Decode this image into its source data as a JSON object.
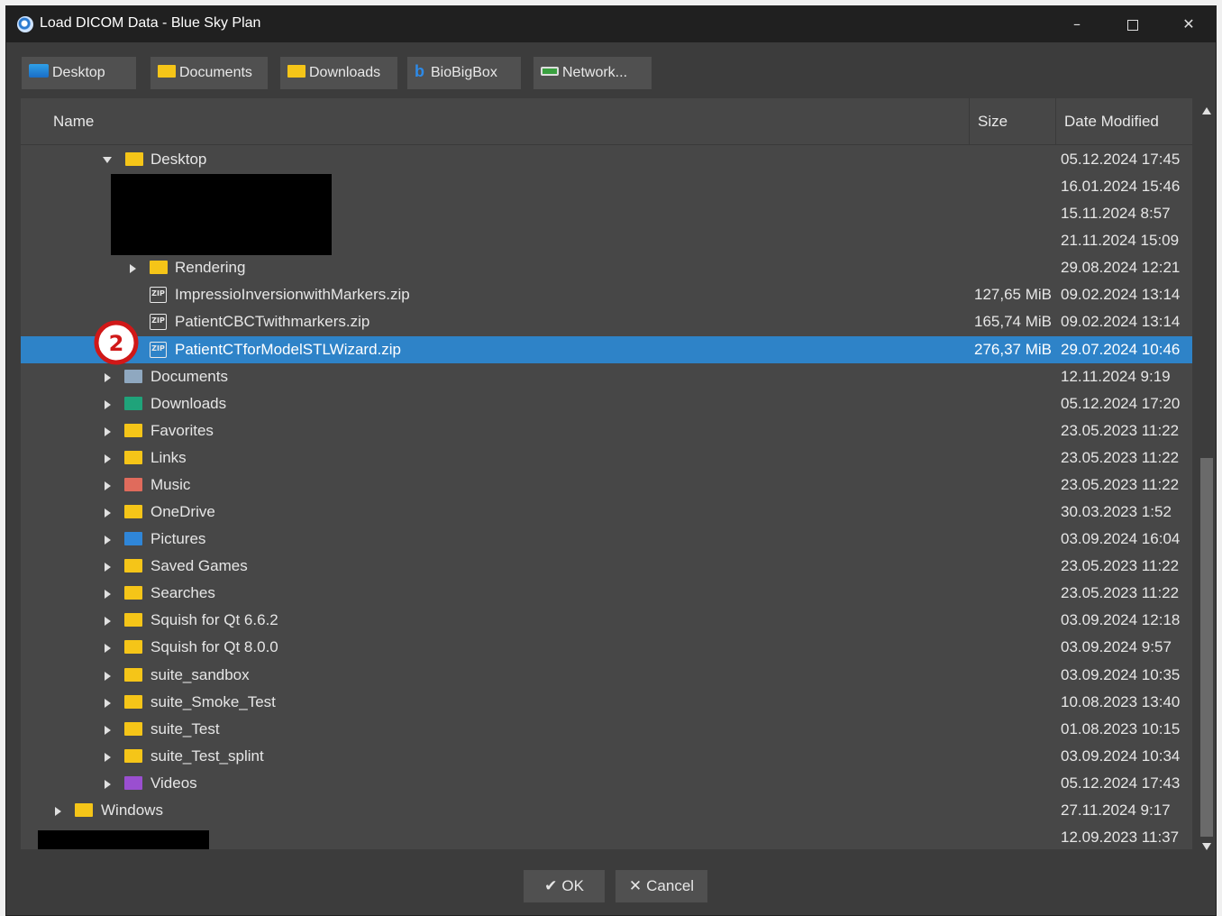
{
  "window": {
    "title": "Load DICOM Data - Blue Sky Plan",
    "minimize": "–",
    "close": "✕"
  },
  "places": [
    {
      "label": "Desktop",
      "icon": "desktop-icon"
    },
    {
      "label": "Documents",
      "icon": "folder-icon"
    },
    {
      "label": "Downloads",
      "icon": "folder-icon"
    },
    {
      "label": "BioBigBox",
      "icon": "biobigbox-icon"
    },
    {
      "label": "Network...",
      "icon": "network-icon"
    }
  ],
  "columns": {
    "name": "Name",
    "size": "Size",
    "date": "Date Modified"
  },
  "rows": [
    {
      "name": "Desktop",
      "size": "",
      "date": "05.12.2024 17:45"
    },
    {
      "name": "",
      "size": "",
      "date": "16.01.2024 15:46"
    },
    {
      "name": "",
      "size": "",
      "date": "15.11.2024 8:57"
    },
    {
      "name": "",
      "size": "",
      "date": "21.11.2024 15:09"
    },
    {
      "name": "Rendering",
      "size": "",
      "date": "29.08.2024 12:21"
    },
    {
      "name": "ImpressioInversionwithMarkers.zip",
      "size": "127,65 MiB",
      "date": "09.02.2024 13:14"
    },
    {
      "name": "PatientCBCTwithmarkers.zip",
      "size": "165,74 MiB",
      "date": "09.02.2024 13:14"
    },
    {
      "name": "PatientCTforModelSTLWizard.zip",
      "size": "276,37 MiB",
      "date": "29.07.2024 10:46"
    },
    {
      "name": "Documents",
      "size": "",
      "date": "12.11.2024 9:19"
    },
    {
      "name": "Downloads",
      "size": "",
      "date": "05.12.2024 17:20"
    },
    {
      "name": "Favorites",
      "size": "",
      "date": "23.05.2023 11:22"
    },
    {
      "name": "Links",
      "size": "",
      "date": "23.05.2023 11:22"
    },
    {
      "name": "Music",
      "size": "",
      "date": "23.05.2023 11:22"
    },
    {
      "name": "OneDrive",
      "size": "",
      "date": "30.03.2023 1:52"
    },
    {
      "name": "Pictures",
      "size": "",
      "date": "03.09.2024 16:04"
    },
    {
      "name": "Saved Games",
      "size": "",
      "date": "23.05.2023 11:22"
    },
    {
      "name": "Searches",
      "size": "",
      "date": "23.05.2023 11:22"
    },
    {
      "name": "Squish for Qt 6.6.2",
      "size": "",
      "date": "03.09.2024 12:18"
    },
    {
      "name": "Squish for Qt 8.0.0",
      "size": "",
      "date": "03.09.2024 9:57"
    },
    {
      "name": "suite_sandbox",
      "size": "",
      "date": "03.09.2024 10:35"
    },
    {
      "name": "suite_Smoke_Test",
      "size": "",
      "date": "10.08.2023 13:40"
    },
    {
      "name": "suite_Test",
      "size": "",
      "date": "01.08.2023 10:15"
    },
    {
      "name": "suite_Test_splint",
      "size": "",
      "date": "03.09.2024 10:34"
    },
    {
      "name": "Videos",
      "size": "",
      "date": "05.12.2024 17:43"
    },
    {
      "name": "Windows",
      "size": "",
      "date": "27.11.2024 9:17"
    },
    {
      "name": "",
      "size": "",
      "date": "12.09.2023 11:37"
    }
  ],
  "selected_row": 7,
  "annotation_badge": "2",
  "buttons": {
    "ok": "OK",
    "cancel": "Cancel"
  },
  "colors": {
    "selection": "#2e83c8",
    "folder": "#f5c518",
    "badge": "#d01818"
  }
}
